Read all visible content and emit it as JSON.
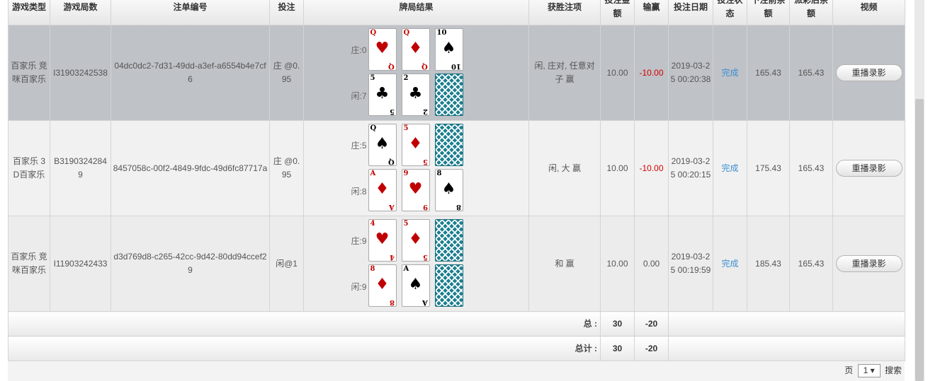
{
  "headers": [
    "游戏类型",
    "游戏局数",
    "注单编号",
    "投注",
    "牌局结果",
    "获胜注项",
    "投注金额",
    "输赢",
    "投注日期",
    "投注状态",
    "下注前余额",
    "派彩后余额",
    "视频"
  ],
  "rows": [
    {
      "game_type": "百家乐 竞咪百家乐",
      "round": "I31903242538",
      "bet_id": "04dc0dc2-7d31-49dd-a3ef-a6554b4e7cf6",
      "bet": "庄 @0.95",
      "banker_label": "庄:0",
      "player_label": "闲:7",
      "banker_cards": [
        {
          "rank": "Q",
          "suit": "♥",
          "color": "red"
        },
        {
          "rank": "Q",
          "suit": "♦",
          "color": "red"
        },
        {
          "rank": "10",
          "suit": "♠",
          "color": "blk"
        }
      ],
      "player_cards": [
        {
          "rank": "5",
          "suit": "♣",
          "color": "blk"
        },
        {
          "rank": "2",
          "suit": "♣",
          "color": "blk"
        },
        {
          "rank": "",
          "suit": "",
          "color": "back"
        }
      ],
      "win_items": "闲, 庄对, 任意对子 赢",
      "amount": "10.00",
      "win_loss": "-10.00",
      "date": "2019-03-25 00:20:38",
      "status": "完成",
      "balance_before": "165.43",
      "balance_after": "165.43",
      "video_btn": "重播录影"
    },
    {
      "game_type": "百家乐 3D百家乐",
      "round": "B31903242849",
      "bet_id": "8457058c-00f2-4849-9fdc-49d6fc87717a",
      "bet": "庄 @0.95",
      "banker_label": "庄:5",
      "player_label": "闲:8",
      "banker_cards": [
        {
          "rank": "Q",
          "suit": "♠",
          "color": "blk"
        },
        {
          "rank": "5",
          "suit": "♦",
          "color": "red"
        },
        {
          "rank": "",
          "suit": "",
          "color": "back"
        }
      ],
      "player_cards": [
        {
          "rank": "A",
          "suit": "♦",
          "color": "red"
        },
        {
          "rank": "9",
          "suit": "♥",
          "color": "red"
        },
        {
          "rank": "8",
          "suit": "♠",
          "color": "blk"
        }
      ],
      "win_items": "闲, 大 赢",
      "amount": "10.00",
      "win_loss": "-10.00",
      "date": "2019-03-25 00:20:15",
      "status": "完成",
      "balance_before": "175.43",
      "balance_after": "165.43",
      "video_btn": "重播录影"
    },
    {
      "game_type": "百家乐 竞咪百家乐",
      "round": "I11903242433",
      "bet_id": "d3d769d8-c265-42cc-9d42-80dd94ccef29",
      "bet": "闲@1",
      "banker_label": "庄:9",
      "player_label": "闲:9",
      "banker_cards": [
        {
          "rank": "4",
          "suit": "♥",
          "color": "red"
        },
        {
          "rank": "5",
          "suit": "♦",
          "color": "red"
        },
        {
          "rank": "",
          "suit": "",
          "color": "back"
        }
      ],
      "player_cards": [
        {
          "rank": "8",
          "suit": "♦",
          "color": "red"
        },
        {
          "rank": "A",
          "suit": "♠",
          "color": "blk"
        },
        {
          "rank": "",
          "suit": "",
          "color": "back"
        }
      ],
      "win_items": "和 赢",
      "amount": "10.00",
      "win_loss": "0.00",
      "date": "2019-03-25 00:19:59",
      "status": "完成",
      "balance_before": "185.43",
      "balance_after": "165.43",
      "video_btn": "重播录影"
    }
  ],
  "totals": [
    {
      "label": "总 :",
      "amount": "30",
      "win_loss": "-20"
    },
    {
      "label": "总计 :",
      "amount": "30",
      "win_loss": "-20"
    }
  ],
  "pager": {
    "page_label": "页",
    "page_value": "1",
    "search_label": "搜索"
  }
}
